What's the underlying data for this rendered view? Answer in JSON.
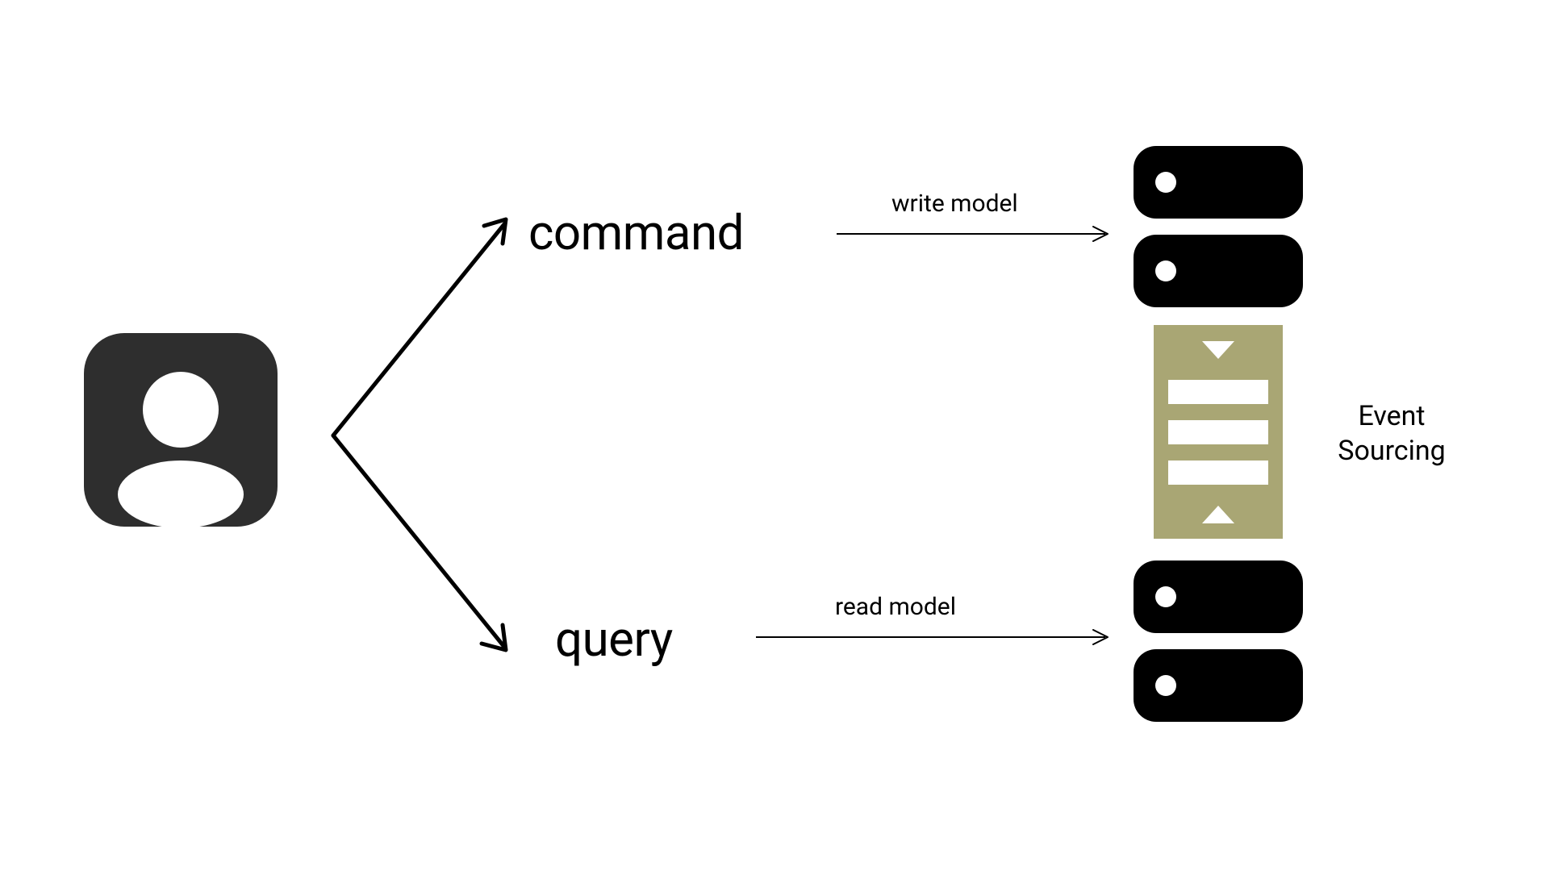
{
  "labels": {
    "command": "command",
    "query": "query",
    "write_model": "write model",
    "read_model": "read model",
    "event_sourcing_line1": "Event",
    "event_sourcing_line2": "Sourcing"
  },
  "colors": {
    "user_icon": "#2e2e2e",
    "server": "#000000",
    "server_light": "#ffffff",
    "event_block": "#a9a674",
    "event_accent": "#ffffff",
    "arrow": "#000000"
  },
  "icons": {
    "user": "user-icon",
    "server_top": "server-icon",
    "server_bottom": "server-icon",
    "event_sourcing": "event-sourcing-icon"
  }
}
